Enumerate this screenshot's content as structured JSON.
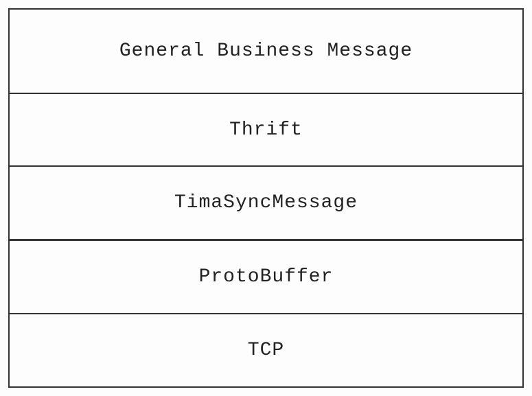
{
  "diagram": {
    "layers": [
      {
        "label": "General Business Message"
      },
      {
        "label": "Thrift"
      },
      {
        "label": "TimaSyncMessage"
      },
      {
        "label": "ProtoBuffer"
      },
      {
        "label": "TCP"
      }
    ]
  }
}
